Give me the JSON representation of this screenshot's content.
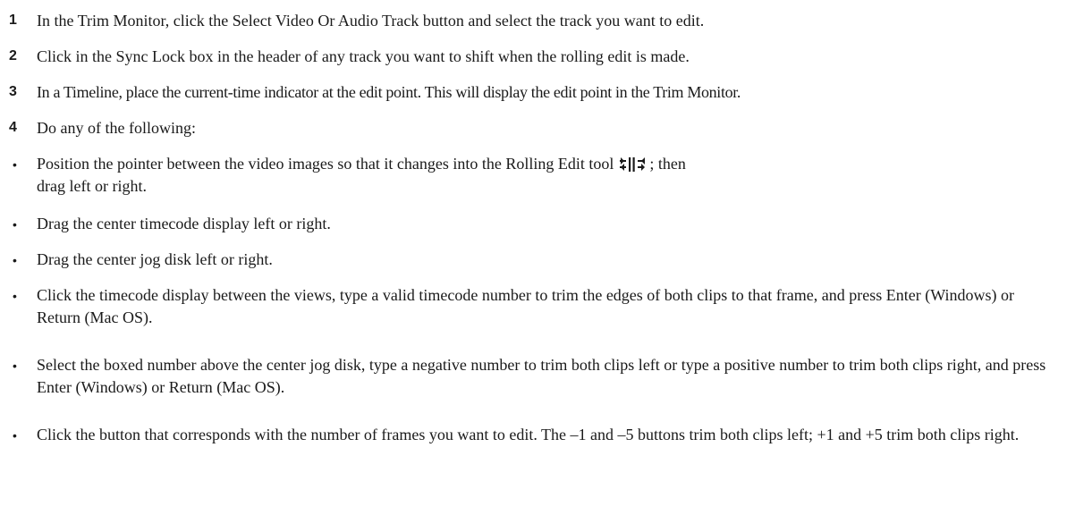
{
  "steps": [
    {
      "num": "1",
      "text": "In the Trim Monitor, click the Select Video Or Audio Track button and select the track you want to edit."
    },
    {
      "num": "2",
      "text": "Click in the Sync Lock box in the header of any track you want to shift when the rolling edit is made."
    },
    {
      "num": "3",
      "text": "In a Timeline, place the current-time indicator at the edit point. This will display the edit point in the Trim Monitor."
    },
    {
      "num": "4",
      "text": "Do any of the following:"
    }
  ],
  "bullets": {
    "symbol": "•",
    "b1_before": "Position the pointer between the video images so that it changes into the Rolling Edit tool",
    "b1_after": "; then drag left or right.",
    "b1_icon": "rolling-edit-tool-icon",
    "b2": "Drag the center timecode display left or right.",
    "b3": "Drag the center jog disk left or right.",
    "b4": "Click the timecode display between the views, type a valid timecode number to trim the edges of both clips to that frame, and press Enter (Windows) or Return (Mac OS).",
    "b5": "Select the boxed number above the center jog disk, type a negative number to trim both clips left or type a positive number to trim both clips right, and press Enter (Windows) or Return (Mac OS).",
    "b6": "Click the button that corresponds with the number of frames you want to edit. The –1 and –5 buttons trim both clips left; +1 and +5 trim both clips right."
  }
}
